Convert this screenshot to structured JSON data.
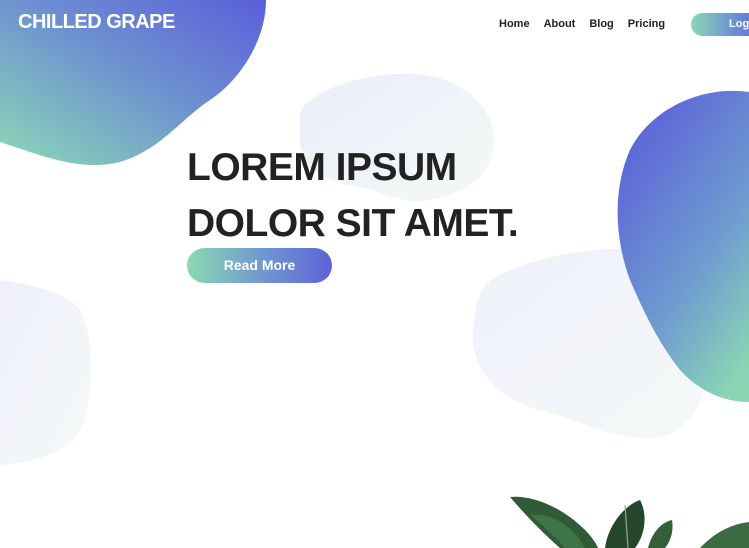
{
  "brand": {
    "name": "CHILLED GRAPE"
  },
  "nav": {
    "items": [
      {
        "label": "Home"
      },
      {
        "label": "About"
      },
      {
        "label": "Blog"
      },
      {
        "label": "Pricing"
      }
    ],
    "login_label": "Login"
  },
  "hero": {
    "title_line_1": "LOREM IPSUM",
    "title_line_2": "DOLOR SIT AMET.",
    "cta_label": "Read More"
  },
  "theme": {
    "gradient_start": "#8bd7b6",
    "gradient_end": "#5c62d8",
    "pale_blob": "#f1f2fb",
    "text_color": "#222222",
    "plant_green": "#2e5a34"
  },
  "decor": {
    "plant_image": "plant-leaves-illustration"
  }
}
